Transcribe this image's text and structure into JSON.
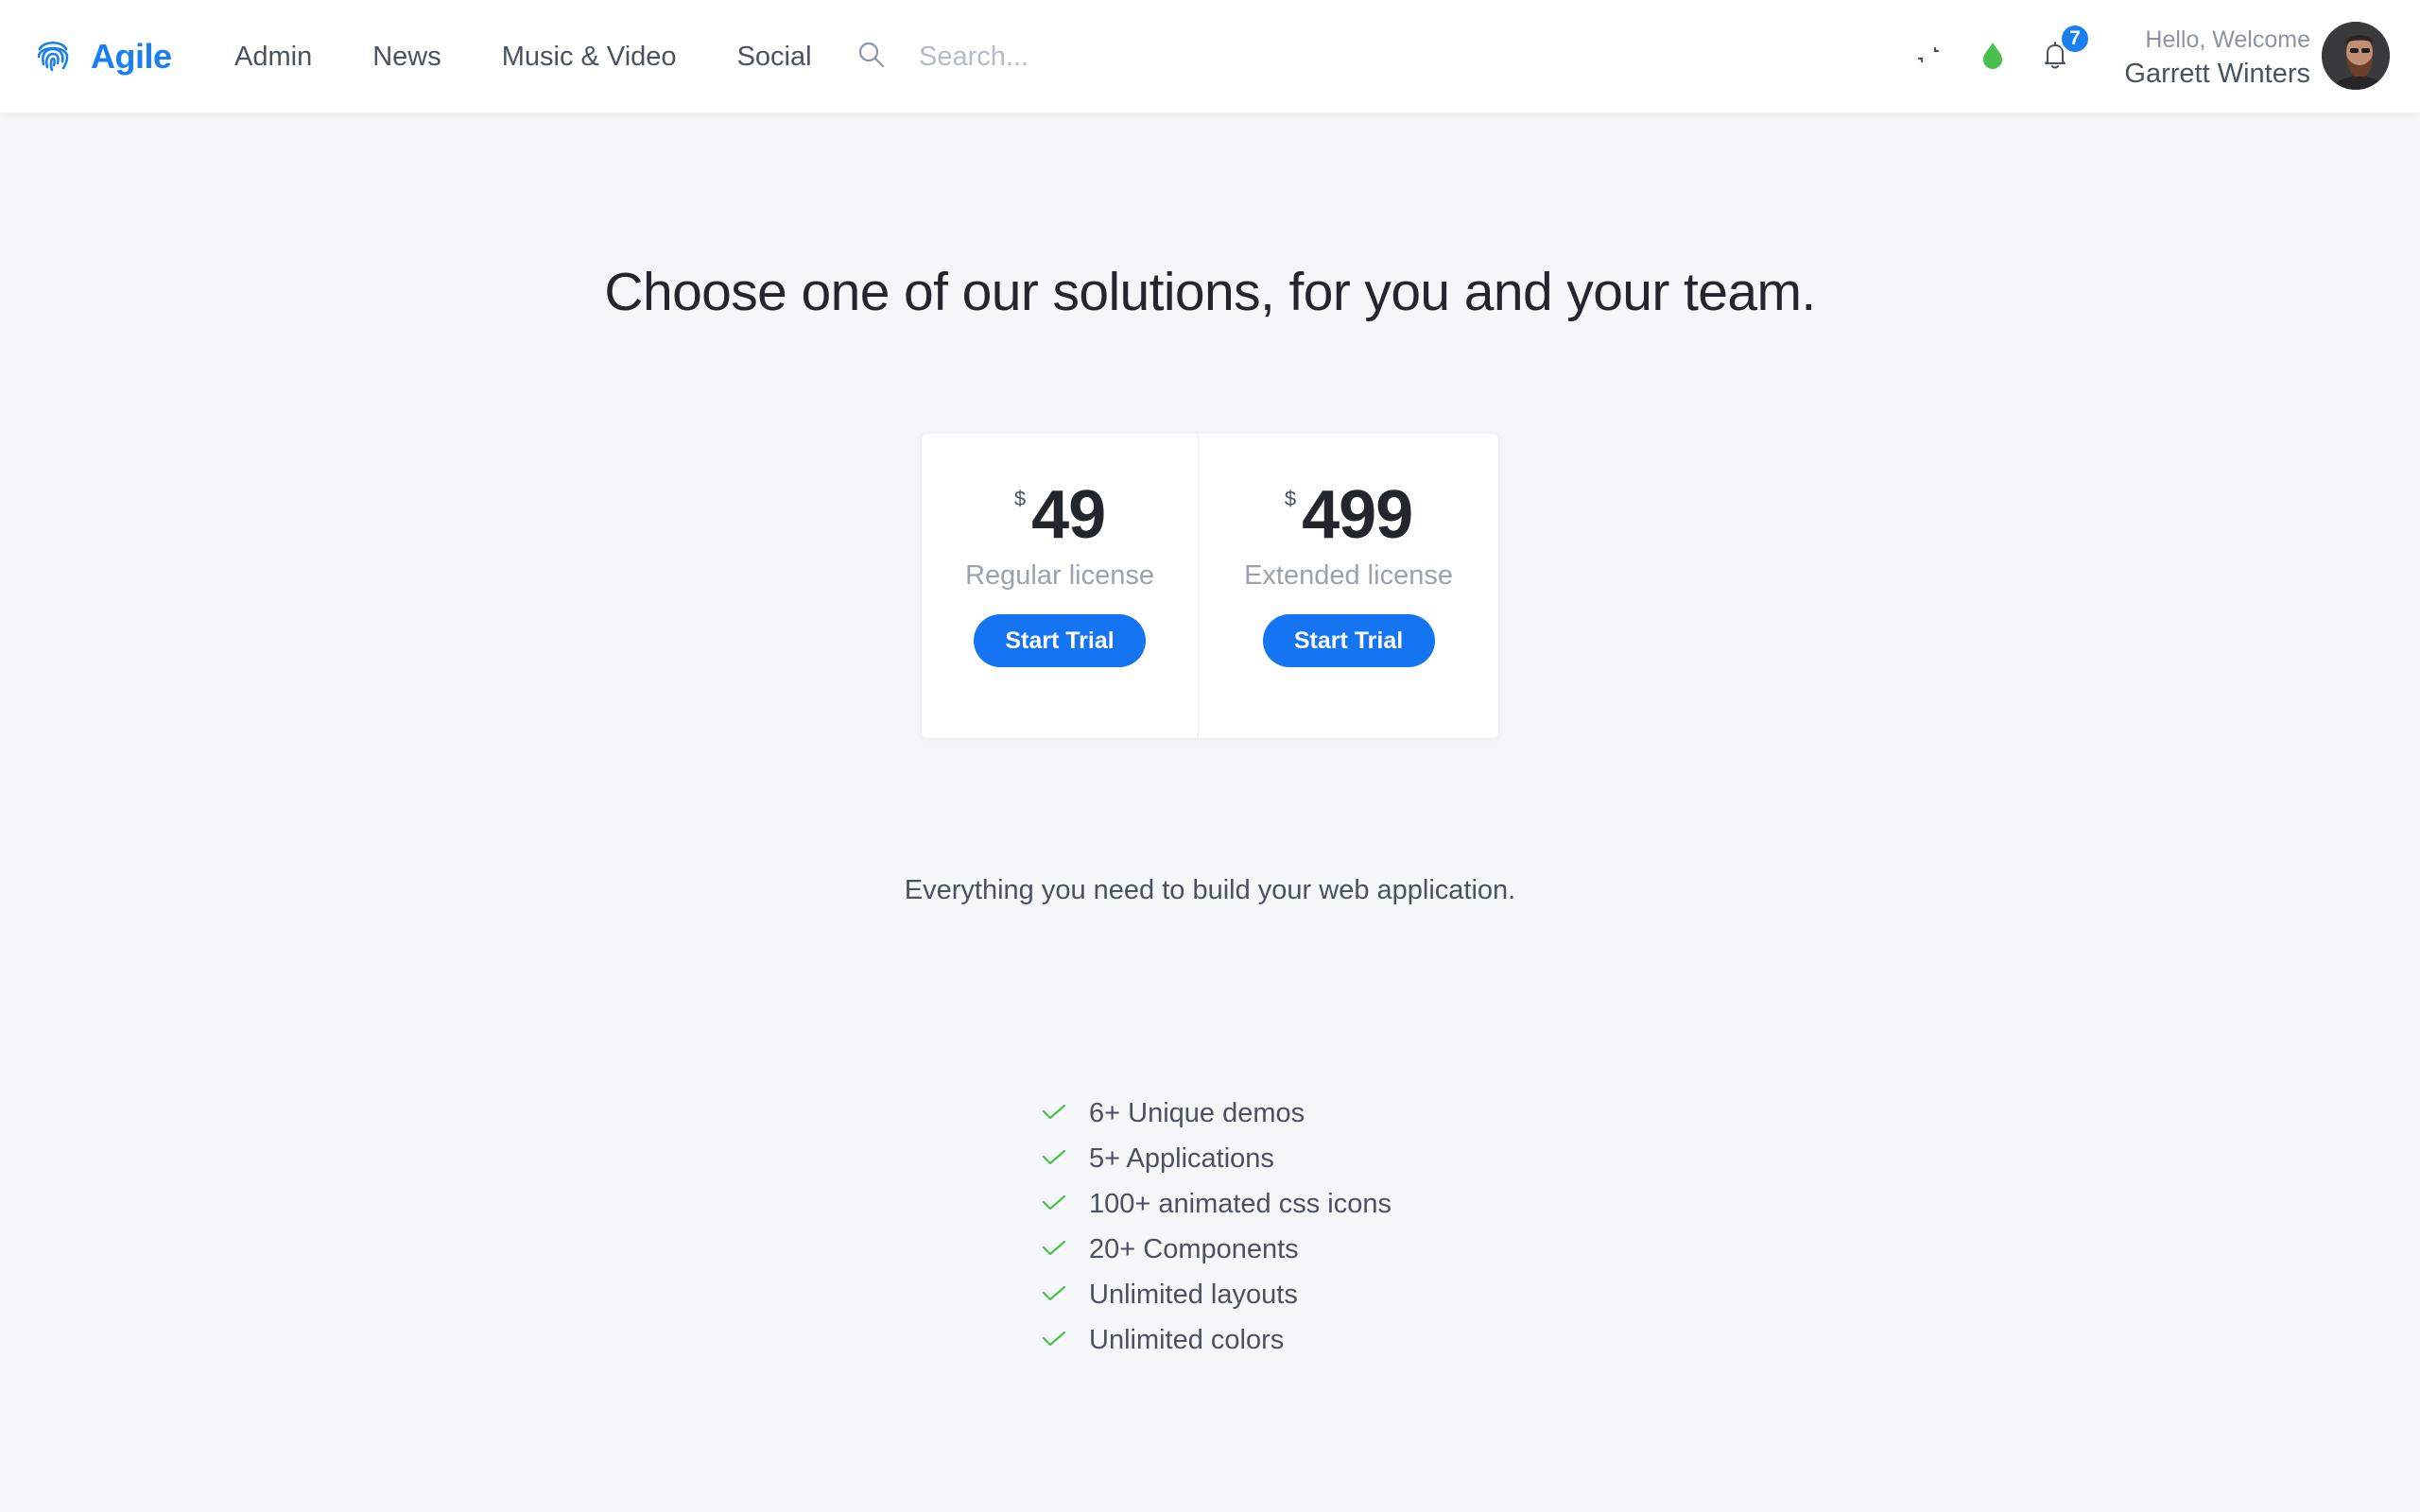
{
  "colors": {
    "accent": "#1a7ff0",
    "button": "#1474f2",
    "check": "#4bbf4e",
    "status_dot": "#4bbf4e",
    "background": "#f5f6f8"
  },
  "header": {
    "brand": {
      "name": "Agile",
      "icon": "fingerprint-icon"
    },
    "nav": [
      {
        "label": "Admin"
      },
      {
        "label": "News"
      },
      {
        "label": "Music & Video"
      },
      {
        "label": "Social"
      }
    ],
    "search": {
      "placeholder": "Search...",
      "value": "",
      "icon": "search-icon"
    },
    "tools": [
      {
        "icon": "loading-spinner-icon"
      },
      {
        "icon": "drop-icon"
      },
      {
        "icon": "bell-icon",
        "badge": "7"
      }
    ],
    "user": {
      "greeting": "Hello, Welcome",
      "name": "Garrett Winters"
    }
  },
  "main": {
    "headline": "Choose one of our solutions, for you and your team.",
    "plans": [
      {
        "currency": "$",
        "price": "49",
        "name": "Regular license",
        "button": "Start Trial"
      },
      {
        "currency": "$",
        "price": "499",
        "name": "Extended license",
        "button": "Start Trial"
      }
    ],
    "tagline": "Everything you need to build your web application.",
    "features": [
      "6+ Unique demos",
      "5+ Applications",
      "100+ animated css icons",
      "20+ Components",
      "Unlimited layouts",
      "Unlimited colors"
    ]
  }
}
